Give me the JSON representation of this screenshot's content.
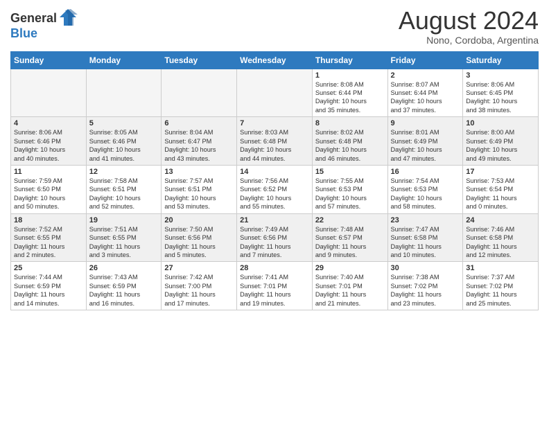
{
  "header": {
    "logo_general": "General",
    "logo_blue": "Blue",
    "main_title": "August 2024",
    "subtitle": "Nono, Cordoba, Argentina"
  },
  "calendar": {
    "days_of_week": [
      "Sunday",
      "Monday",
      "Tuesday",
      "Wednesday",
      "Thursday",
      "Friday",
      "Saturday"
    ],
    "weeks": [
      [
        {
          "day": "",
          "content": ""
        },
        {
          "day": "",
          "content": ""
        },
        {
          "day": "",
          "content": ""
        },
        {
          "day": "",
          "content": ""
        },
        {
          "day": "1",
          "content": "Sunrise: 8:08 AM\nSunset: 6:44 PM\nDaylight: 10 hours\nand 35 minutes."
        },
        {
          "day": "2",
          "content": "Sunrise: 8:07 AM\nSunset: 6:44 PM\nDaylight: 10 hours\nand 37 minutes."
        },
        {
          "day": "3",
          "content": "Sunrise: 8:06 AM\nSunset: 6:45 PM\nDaylight: 10 hours\nand 38 minutes."
        }
      ],
      [
        {
          "day": "4",
          "content": "Sunrise: 8:06 AM\nSunset: 6:46 PM\nDaylight: 10 hours\nand 40 minutes."
        },
        {
          "day": "5",
          "content": "Sunrise: 8:05 AM\nSunset: 6:46 PM\nDaylight: 10 hours\nand 41 minutes."
        },
        {
          "day": "6",
          "content": "Sunrise: 8:04 AM\nSunset: 6:47 PM\nDaylight: 10 hours\nand 43 minutes."
        },
        {
          "day": "7",
          "content": "Sunrise: 8:03 AM\nSunset: 6:48 PM\nDaylight: 10 hours\nand 44 minutes."
        },
        {
          "day": "8",
          "content": "Sunrise: 8:02 AM\nSunset: 6:48 PM\nDaylight: 10 hours\nand 46 minutes."
        },
        {
          "day": "9",
          "content": "Sunrise: 8:01 AM\nSunset: 6:49 PM\nDaylight: 10 hours\nand 47 minutes."
        },
        {
          "day": "10",
          "content": "Sunrise: 8:00 AM\nSunset: 6:49 PM\nDaylight: 10 hours\nand 49 minutes."
        }
      ],
      [
        {
          "day": "11",
          "content": "Sunrise: 7:59 AM\nSunset: 6:50 PM\nDaylight: 10 hours\nand 50 minutes."
        },
        {
          "day": "12",
          "content": "Sunrise: 7:58 AM\nSunset: 6:51 PM\nDaylight: 10 hours\nand 52 minutes."
        },
        {
          "day": "13",
          "content": "Sunrise: 7:57 AM\nSunset: 6:51 PM\nDaylight: 10 hours\nand 53 minutes."
        },
        {
          "day": "14",
          "content": "Sunrise: 7:56 AM\nSunset: 6:52 PM\nDaylight: 10 hours\nand 55 minutes."
        },
        {
          "day": "15",
          "content": "Sunrise: 7:55 AM\nSunset: 6:53 PM\nDaylight: 10 hours\nand 57 minutes."
        },
        {
          "day": "16",
          "content": "Sunrise: 7:54 AM\nSunset: 6:53 PM\nDaylight: 10 hours\nand 58 minutes."
        },
        {
          "day": "17",
          "content": "Sunrise: 7:53 AM\nSunset: 6:54 PM\nDaylight: 11 hours\nand 0 minutes."
        }
      ],
      [
        {
          "day": "18",
          "content": "Sunrise: 7:52 AM\nSunset: 6:55 PM\nDaylight: 11 hours\nand 2 minutes."
        },
        {
          "day": "19",
          "content": "Sunrise: 7:51 AM\nSunset: 6:55 PM\nDaylight: 11 hours\nand 3 minutes."
        },
        {
          "day": "20",
          "content": "Sunrise: 7:50 AM\nSunset: 6:56 PM\nDaylight: 11 hours\nand 5 minutes."
        },
        {
          "day": "21",
          "content": "Sunrise: 7:49 AM\nSunset: 6:56 PM\nDaylight: 11 hours\nand 7 minutes."
        },
        {
          "day": "22",
          "content": "Sunrise: 7:48 AM\nSunset: 6:57 PM\nDaylight: 11 hours\nand 9 minutes."
        },
        {
          "day": "23",
          "content": "Sunrise: 7:47 AM\nSunset: 6:58 PM\nDaylight: 11 hours\nand 10 minutes."
        },
        {
          "day": "24",
          "content": "Sunrise: 7:46 AM\nSunset: 6:58 PM\nDaylight: 11 hours\nand 12 minutes."
        }
      ],
      [
        {
          "day": "25",
          "content": "Sunrise: 7:44 AM\nSunset: 6:59 PM\nDaylight: 11 hours\nand 14 minutes."
        },
        {
          "day": "26",
          "content": "Sunrise: 7:43 AM\nSunset: 6:59 PM\nDaylight: 11 hours\nand 16 minutes."
        },
        {
          "day": "27",
          "content": "Sunrise: 7:42 AM\nSunset: 7:00 PM\nDaylight: 11 hours\nand 17 minutes."
        },
        {
          "day": "28",
          "content": "Sunrise: 7:41 AM\nSunset: 7:01 PM\nDaylight: 11 hours\nand 19 minutes."
        },
        {
          "day": "29",
          "content": "Sunrise: 7:40 AM\nSunset: 7:01 PM\nDaylight: 11 hours\nand 21 minutes."
        },
        {
          "day": "30",
          "content": "Sunrise: 7:38 AM\nSunset: 7:02 PM\nDaylight: 11 hours\nand 23 minutes."
        },
        {
          "day": "31",
          "content": "Sunrise: 7:37 AM\nSunset: 7:02 PM\nDaylight: 11 hours\nand 25 minutes."
        }
      ]
    ]
  }
}
